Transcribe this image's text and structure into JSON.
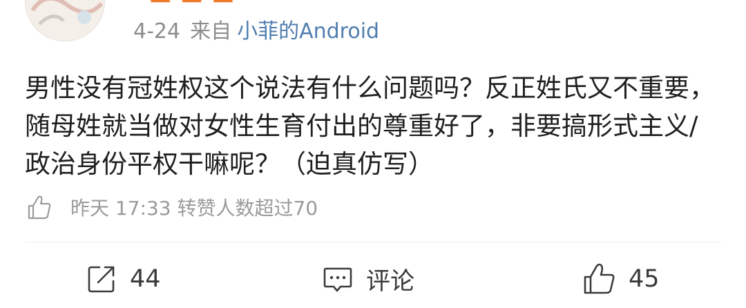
{
  "post": {
    "date": "4-24",
    "from_label": "来自",
    "device": "小菲的Android",
    "content": "男性没有冠姓权这个说法有什么问题吗？反正姓氏又不重要，随母姓就当做对女性生育付出的尊重好了，非要搞形式主义/政治身份平权干嘛呢？（迫真仿写）",
    "liked_info": "昨天 17:33 转赞人数超过70"
  },
  "actions": {
    "repost_count": "44",
    "comment_label": "评论",
    "like_count": "45"
  },
  "colors": {
    "link": "#507daf",
    "meta": "#8c8c8c",
    "name": "#f07a2b"
  },
  "icons": [
    "avatar",
    "thumb-up-icon",
    "share-icon",
    "comment-icon",
    "like-icon"
  ]
}
